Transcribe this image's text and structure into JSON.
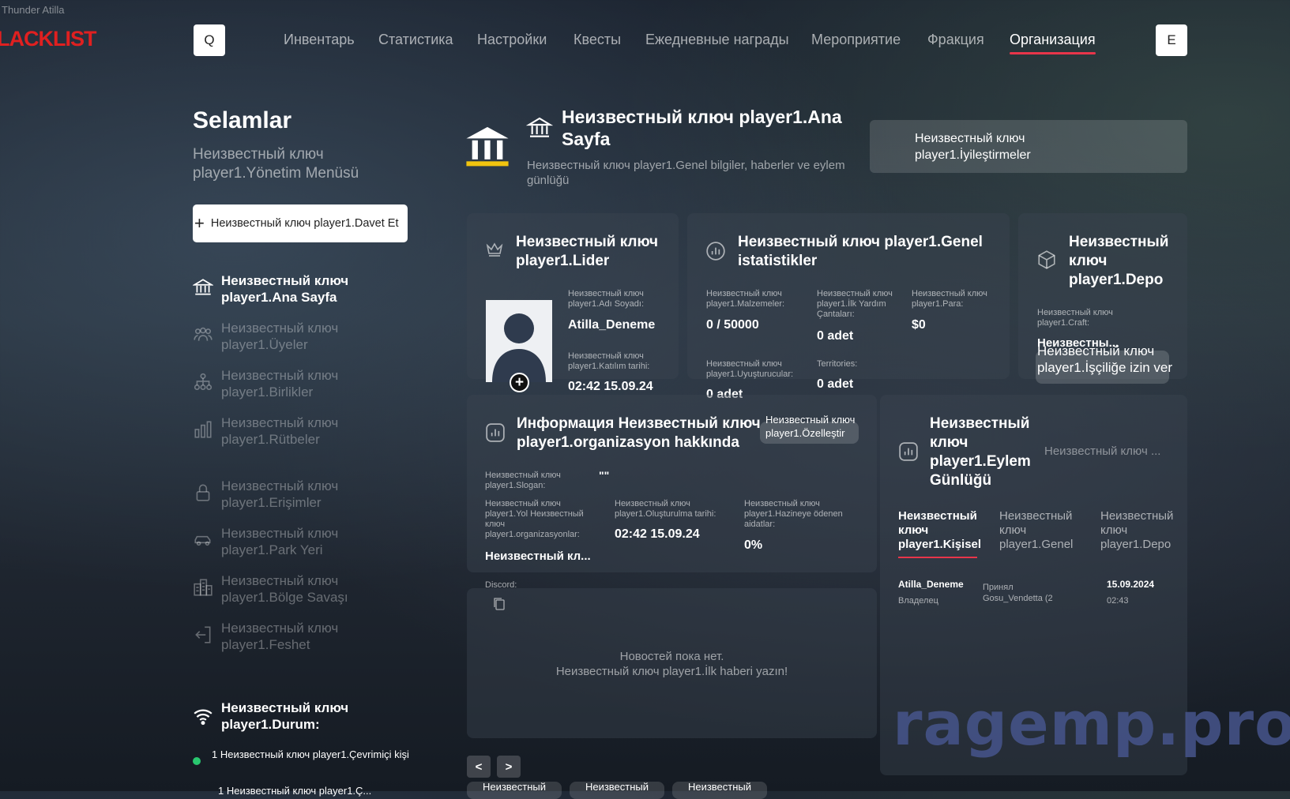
{
  "app": {
    "window_title": "Thunder Atilla",
    "logo_text": "LACKLIST"
  },
  "header": {
    "search_btn": "Q",
    "close_btn": "E",
    "nav": [
      "Инвентарь",
      "Статистика",
      "Настройки",
      "Квесты",
      "Ежедневные награды",
      "Мероприятие",
      "Фракция",
      "Организация"
    ],
    "active_index": 7
  },
  "sidebar": {
    "greeting": "Selamlar",
    "subtitle": "Неизвестный ключ player1.Yönetim Menüsü",
    "invite_btn": "Неизвестный ключ player1.Davet Et",
    "items": [
      {
        "label": "Неизвестный ключ player1.Ana Sayfa",
        "icon": "bank-icon"
      },
      {
        "label": "Неизвестный ключ player1.Üyeler",
        "icon": "members-icon"
      },
      {
        "label": "Неизвестный ключ player1.Birlikler",
        "icon": "hierarchy-icon"
      },
      {
        "label": "Неизвестный ключ player1.Rütbeler",
        "icon": "bar-chart-icon"
      },
      {
        "label": "Неизвестный ключ player1.Erişimler",
        "icon": "lock-icon"
      },
      {
        "label": "Неизвестный ключ player1.Park Yeri",
        "icon": "car-icon"
      },
      {
        "label": "Неизвестный ключ player1.Bölge Savaşı",
        "icon": "buildings-icon"
      },
      {
        "label": "Неизвестный ключ player1.Feshet",
        "icon": "exit-door-icon"
      }
    ],
    "status_title": "Неизвестный ключ player1.Durum:",
    "online_text": "1 Неизвестный ключ player1.Çevrimiçi kişi",
    "second_status_text": "1 Неизвестный ключ player1.Ç..."
  },
  "main": {
    "title": "Неизвестный ключ player1.Ana Sayfa",
    "subtitle": "Неизвестный ключ player1.Genel bilgiler, haberler ve eylem günlüğü",
    "improve_btn": "Неизвестный ключ player1.İyileştirmeler",
    "leader": {
      "title": "Неизвестный ключ player1.Lider",
      "name_label": "Неизвестный ключ player1.Adı Soyadı:",
      "name": "Atilla_Deneme",
      "join_label": "Неизвестный ключ player1.Katılım tarihi:",
      "join_date": "02:42 15.09.24",
      "add_btn": "+"
    },
    "stats": {
      "title": "Неизвестный ключ player1.Genel istatistikler",
      "materials_label": "Неизвестный ключ player1.Malzemeler:",
      "materials": "0 / 50000",
      "firstaid_label": "Неизвестный ключ player1.İlk Yardım Çantaları:",
      "firstaid": "0 adet",
      "money_label": "Неизвестный ключ player1.Para:",
      "money": "$0",
      "drugs_label": "Неизвестный ключ player1.Uyuşturucular:",
      "drugs": "0 adet",
      "territories_label": "Territories:",
      "territories": "0 adet"
    },
    "depot": {
      "title": "Неизвестный ключ player1.Depo",
      "craft_label": "Неизвестный ключ player1.Craft:",
      "craft_value": "Неизвестны...",
      "allow_btn": "Неизвестный ключ player1.İşçiliğe izin ver"
    },
    "info": {
      "title": "Информация Неизвестный ключ player1.organizasyon hakkında",
      "customize_btn": "Неизвестный ключ player1.Özelleştir",
      "slogan_label": "Неизвестный ключ player1.Slogan:",
      "slogan": "\"\"",
      "path_label": "Неизвестный ключ player1.Yol Неизвестный ключ player1.organizasyonlar:",
      "path_value": "Неизвестный кл...",
      "created_label": "Неизвестный ключ player1.Oluşturulma tarihi:",
      "created": "02:42 15.09.24",
      "treasury_label": "Неизвестный ключ player1.Hazineye ödenen aidatlar:",
      "treasury": "0%"
    },
    "news": {
      "discord_label": "Discord:",
      "empty_line1": "Новостей пока нет.",
      "empty_line2": "Неизвестный ключ player1.İlk haberi yazın!"
    },
    "log": {
      "title": "Неизвестный ключ player1.Eylem Günlüğü",
      "filter": "Неизвестный ключ ...",
      "tabs": [
        "Неизвестный ключ player1.Kişisel",
        "Неизвестный ключ player1.Genel",
        "Неизвестный ключ player1.Depo"
      ],
      "entry": {
        "name": "Atilla_Deneme",
        "role": "Владелец",
        "action": "Принял",
        "target": "Gosu_Vendetta (2",
        "date": "15.09.2024",
        "time": "02:43"
      }
    },
    "pager": {
      "prev": "<",
      "next": ">",
      "tabs": [
        "Неизвестный",
        "Неизвестный",
        "Неизвестный"
      ]
    }
  },
  "watermark": "ragemp.pro"
}
